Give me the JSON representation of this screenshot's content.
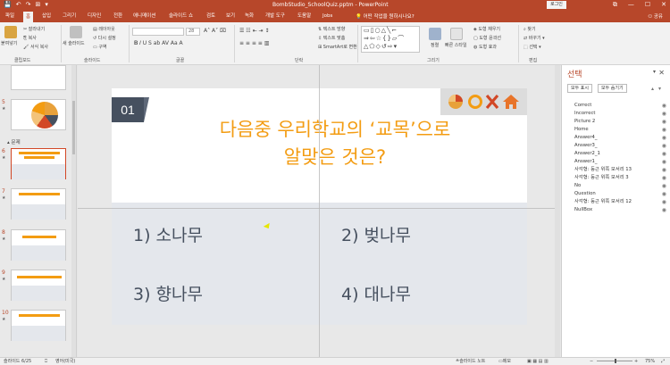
{
  "titlebar": {
    "title": "BombStudio_SchoolQuiz.pptm - PowerPoint",
    "login_label": "로그인",
    "quick_access": [
      "💾",
      "↶",
      "↷",
      "⊞",
      "▾"
    ],
    "window_buttons": [
      "⧉",
      "—",
      "☐",
      "✕"
    ]
  },
  "tabs": [
    "파일",
    "홈",
    "삽입",
    "그리기",
    "디자인",
    "전환",
    "애니메이션",
    "슬라이드 쇼",
    "검토",
    "보기",
    "녹화",
    "개발 도구",
    "도움말",
    "Jobs"
  ],
  "active_tab": "홈",
  "tell_me": "어떤 작업을 원하시나요?",
  "share": "공유",
  "ribbon": {
    "paste": "붙여넣기",
    "cut": "잘라내기",
    "copy": "복사",
    "format_painter": "서식 복사",
    "new_slide": "새 슬라이드",
    "layout": "레이아웃",
    "reset": "다시 설정",
    "section": "구역",
    "font_size": "28",
    "text_direction": "텍스트 방향",
    "align_text": "텍스트 맞춤",
    "smartart": "SmartArt로 변환",
    "arrange": "정렬",
    "quick_styles": "빠른 스타일",
    "shape_fill": "도형 채우기",
    "shape_outline": "도형 윤곽선",
    "shape_effects": "도형 효과",
    "find": "찾기",
    "replace": "바꾸기",
    "select": "선택",
    "groups": [
      "클립보드",
      "슬라이드",
      "글꼴",
      "단락",
      "그리기",
      "편집"
    ]
  },
  "thumbnails": {
    "section_label": "문제",
    "numbers": [
      "5",
      "6",
      "7",
      "8",
      "9",
      "10"
    ]
  },
  "slide": {
    "badge": "01",
    "question_line1": "다음중 우리학교의 ‘교목’으로",
    "question_line2": "알맞은 것은?",
    "answers": [
      "1) 소나무",
      "2) 벚나무",
      "3) 향나무",
      "4) 대나무"
    ],
    "colors": {
      "accent": "#f39c12",
      "dark": "#46505f",
      "answer_bg": "#e4e7ec"
    }
  },
  "selection_pane": {
    "title": "선택",
    "show_all": "모두 표시",
    "hide_all": "모두 숨기기",
    "items": [
      "Correct",
      "Incorrect",
      "Picture 2",
      "Home",
      "Answer4_",
      "Answer3_",
      "Answer2_1",
      "Answer1_",
      "사각형: 둥근 위쪽 모서리 13",
      "사각형: 둥근 위쪽 모서리 3",
      "No",
      "Question",
      "사각형: 둥근 위쪽 모서리 12",
      "NullBox"
    ]
  },
  "statusbar": {
    "slide_info": "슬라이드 6/25",
    "language": "영어(미국)",
    "notes": "슬라이드 노트",
    "comments": "메모",
    "zoom": "75%"
  }
}
